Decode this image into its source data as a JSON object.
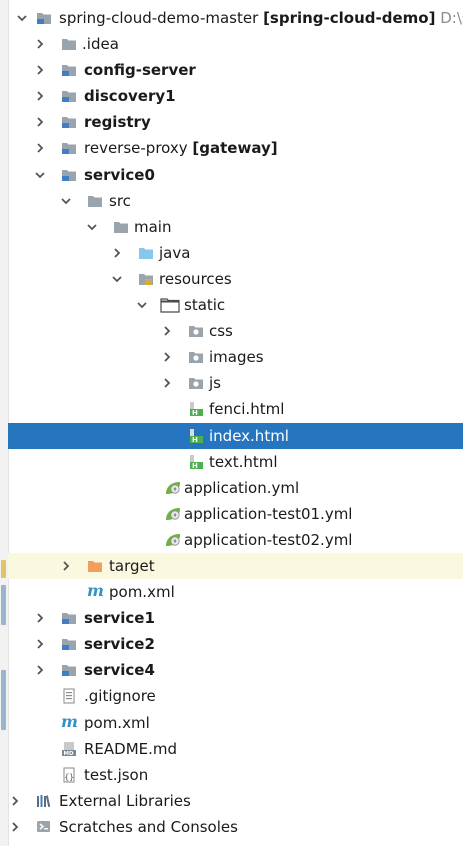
{
  "tree": {
    "root": {
      "name": "spring-cloud-demo-master",
      "module": "[spring-cloud-demo]",
      "path": "D:\\sp"
    },
    "idea": "idea",
    "config_server": "config-server",
    "discovery1": "discovery1",
    "registry": "registry",
    "reverse_proxy": {
      "name": "reverse-proxy",
      "module": "[gateway]"
    },
    "service0": "service0",
    "src": "src",
    "main": "main",
    "java": "java",
    "resources": "resources",
    "static": "static",
    "css": "css",
    "images": "images",
    "js": "js",
    "fenci_html": "fenci.html",
    "index_html": "index.html",
    "text_html": "text.html",
    "application_yml": "application.yml",
    "application_test01_yml": "application-test01.yml",
    "application_test02_yml": "application-test02.yml",
    "target": "target",
    "service0_pom": "pom.xml",
    "service1": "service1",
    "service2": "service2",
    "service4": "service4",
    "gitignore": ".gitignore",
    "root_pom": "pom.xml",
    "readme": "README.md",
    "test_json": "test.json",
    "external_libraries": "External Libraries",
    "scratches": "Scratches and Consoles"
  },
  "colors": {
    "selection": "#2675bf",
    "excluded_background": "#fbf8e0",
    "folder_gray": "#9aa4ad",
    "module_blue": "#3d7fc1",
    "source_blue": "#86c8ec",
    "target_orange": "#f0a05a",
    "spring_green": "#6db33f"
  },
  "icons": {
    "folder": "folder-icon",
    "module": "module-folder-icon",
    "source_root": "source-folder-icon",
    "resources_root": "resources-folder-icon",
    "html_file": "html-file-icon",
    "spring_yml": "spring-config-icon",
    "maven": "maven-pom-icon",
    "text_file": "text-file-icon",
    "markdown": "markdown-file-icon",
    "json": "json-file-icon",
    "libraries": "libraries-icon",
    "scratches": "scratches-icon"
  },
  "selected_item": "index.html"
}
